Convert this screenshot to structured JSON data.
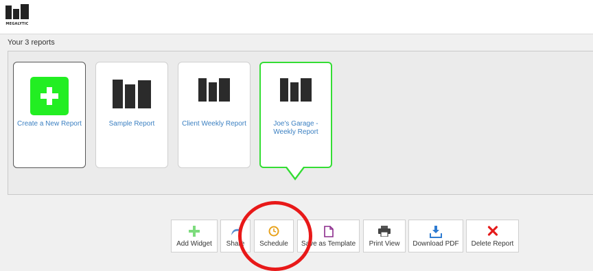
{
  "header": {
    "logo_text": "MEGALYTIC"
  },
  "reports_section": {
    "title": "Your 3 reports"
  },
  "cards": [
    {
      "label": "Create a New Report",
      "icon": "plus-icon"
    },
    {
      "label": "Sample Report",
      "icon": "bar-chart-icon"
    },
    {
      "label": "Client Weekly Report",
      "icon": "bar-chart-icon"
    },
    {
      "label": "Joe's Garage - Weekly Report",
      "icon": "bar-chart-icon",
      "selected": true
    }
  ],
  "toolbar": {
    "add_widget": "Add Widget",
    "share": "Share",
    "schedule": "Schedule",
    "save_as_template": "Save as Template",
    "print_view": "Print View",
    "download_pdf": "Download PDF",
    "delete_report": "Delete Report"
  },
  "colors": {
    "accent_green": "#22ee22",
    "link_blue": "#3a7fc1",
    "annotation_red": "#e81919",
    "schedule_orange": "#e8a21b",
    "template_purple": "#8b2a8b",
    "download_blue": "#2e7bd1",
    "delete_red": "#e51c1c"
  }
}
